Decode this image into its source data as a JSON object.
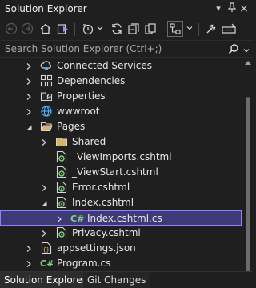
{
  "window": {
    "title": "Solution Explorer",
    "pin_symbol": "⊥",
    "close_symbol": "×",
    "dropdown_symbol": "▾"
  },
  "search": {
    "placeholder": "Search Solution Explorer (Ctrl+;)"
  },
  "tree": [
    {
      "label": "Connected Services",
      "icon": "connected-services-icon",
      "expander": "collapsed"
    },
    {
      "label": "Dependencies",
      "icon": "dependencies-icon",
      "expander": "collapsed"
    },
    {
      "label": "Properties",
      "icon": "properties-icon",
      "expander": "collapsed"
    },
    {
      "label": "wwwroot",
      "icon": "globe-icon",
      "expander": "collapsed"
    },
    {
      "label": "Pages",
      "icon": "folder-open-icon",
      "expander": "expanded"
    },
    {
      "label": "Shared",
      "icon": "folder-icon",
      "expander": "collapsed"
    },
    {
      "label": "_ViewImports.cshtml",
      "icon": "razor-file-icon",
      "expander": "none"
    },
    {
      "label": "_ViewStart.cshtml",
      "icon": "razor-file-icon",
      "expander": "none"
    },
    {
      "label": "Error.cshtml",
      "icon": "razor-file-icon",
      "expander": "collapsed"
    },
    {
      "label": "Index.cshtml",
      "icon": "razor-file-icon",
      "expander": "expanded"
    },
    {
      "label": "Index.cshtml.cs",
      "icon": "csharp-file-icon",
      "expander": "collapsed",
      "selected": true
    },
    {
      "label": "Privacy.cshtml",
      "icon": "razor-file-icon",
      "expander": "collapsed"
    },
    {
      "label": "appsettings.json",
      "icon": "json-file-icon",
      "expander": "collapsed"
    },
    {
      "label": "Program.cs",
      "icon": "csharp-file-icon",
      "expander": "collapsed"
    }
  ],
  "tabs": [
    {
      "label": "Solution Explorer",
      "active": true
    },
    {
      "label": "Git Changes",
      "active": false
    }
  ],
  "colors": {
    "background": "#1f1f1f",
    "selection": "#3e3a78",
    "selection_border": "#8a82ff",
    "csharp_icon": "#7fd17f"
  }
}
